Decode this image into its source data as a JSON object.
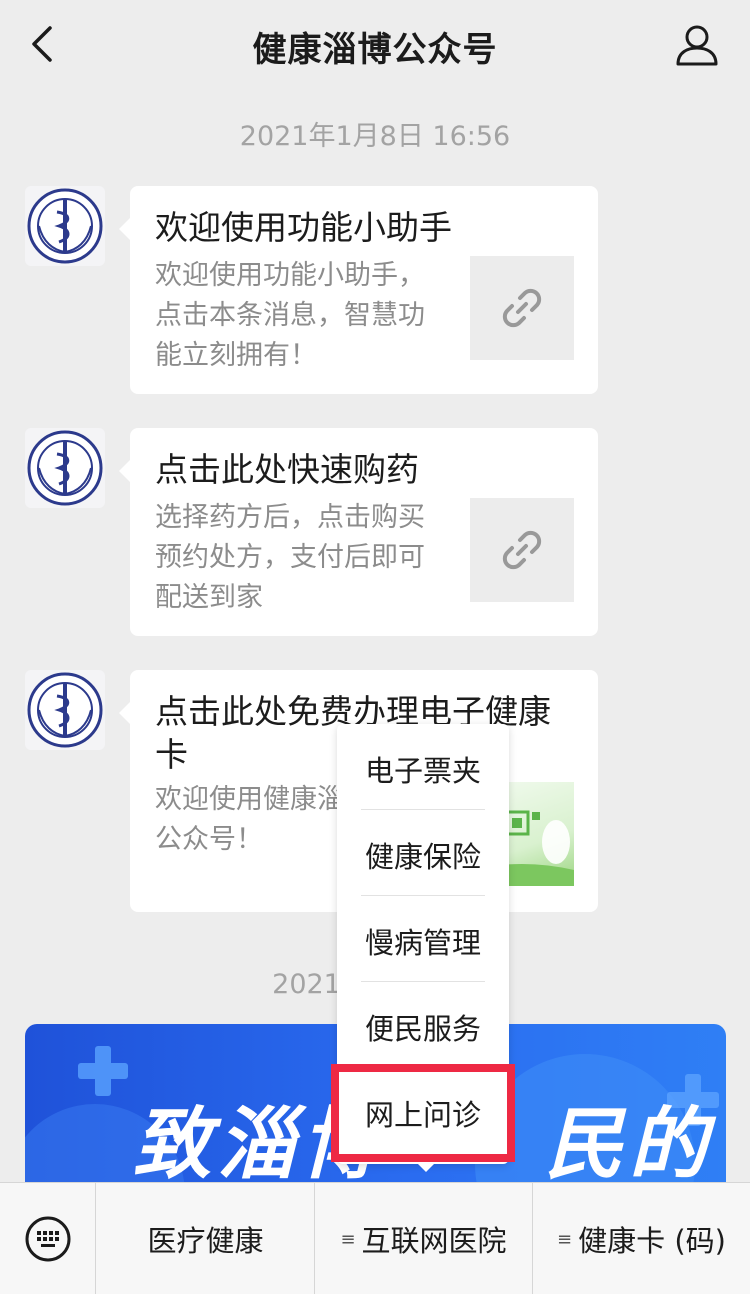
{
  "header": {
    "title": "健康淄博公众号",
    "back_icon": "chevron-left-icon",
    "profile_icon": "person-icon"
  },
  "timestamps": [
    "2021年1月8日 16:56",
    "2021年"
  ],
  "messages": [
    {
      "title": "欢迎使用功能小助手",
      "desc_lines": [
        "欢迎使用功能小助手，",
        "点击本条消息，智慧功",
        "能立刻拥有！"
      ],
      "thumb": "link-icon"
    },
    {
      "title": "点击此处快速购药",
      "desc_lines": [
        "选择药方后，点击购买",
        "预约处方，支付后即可",
        "配送到家"
      ],
      "thumb": "link-icon"
    },
    {
      "title_lines": [
        "点击此处免费办理电子健康",
        "卡"
      ],
      "desc_lines": [
        "欢迎使用健康淄",
        "公众号！"
      ],
      "thumb": "health-card-image"
    }
  ],
  "banner": {
    "text": "致淄博",
    "text_right": "民的"
  },
  "popup_menu": {
    "items": [
      "电子票夹",
      "健康保险",
      "慢病管理",
      "便民服务",
      "网上问诊"
    ],
    "highlighted": "网上问诊",
    "highlight_color": "#ee2944"
  },
  "menubar": {
    "keyboard_icon": "keyboard-icon",
    "items": [
      {
        "label": "医疗健康",
        "has_submenu": false
      },
      {
        "label": "互联网医院",
        "has_submenu": true
      },
      {
        "label": "健康卡 (码)",
        "has_submenu": true
      }
    ]
  },
  "colors": {
    "background": "#ededed",
    "banner_blue": "#2a6cf0",
    "highlight": "#ee2944"
  }
}
